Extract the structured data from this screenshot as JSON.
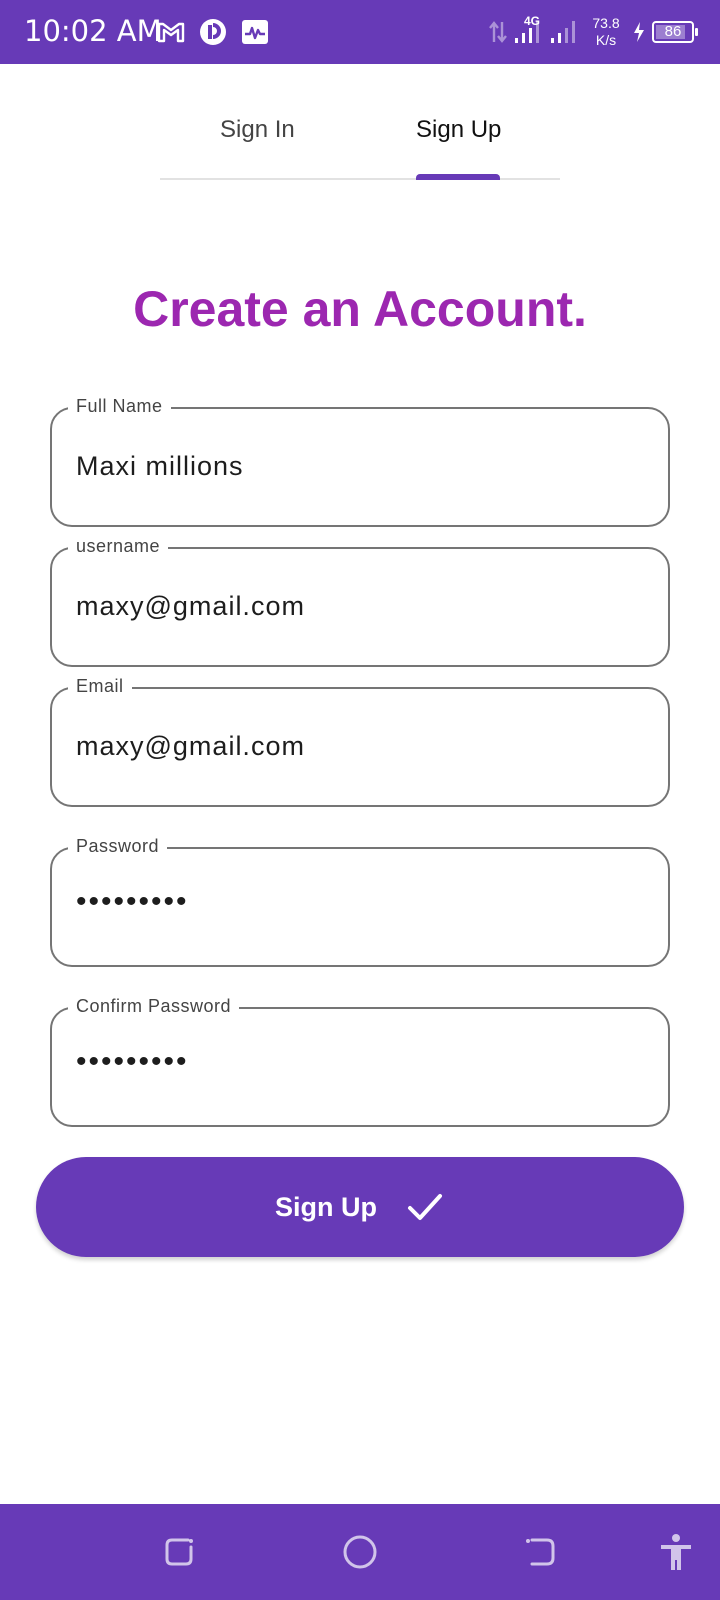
{
  "status_bar": {
    "time": "10:02 AM",
    "network_type": "4G",
    "net_speed_value": "73.8",
    "net_speed_unit": "K/s",
    "battery_level": "86",
    "battery_fraction": 0.86,
    "icons_left": [
      "gmail-icon",
      "app-r-icon",
      "activity-monitor-icon"
    ]
  },
  "tabs": {
    "sign_in": "Sign In",
    "sign_up": "Sign Up",
    "selected": "Sign Up"
  },
  "heading": "Create an Account.",
  "form": {
    "full_name": {
      "label": "Full Name",
      "value": "Maxi millions"
    },
    "username": {
      "label": "username",
      "value": "maxy@gmail.com"
    },
    "email": {
      "label": "Email",
      "value": "maxy@gmail.com"
    },
    "password": {
      "label": "Password",
      "value": "•••••••••"
    },
    "confirm_password": {
      "label": "Confirm Password",
      "value": "•••••••••"
    }
  },
  "submit_button": {
    "label": "Sign Up",
    "icon": "check-icon"
  },
  "nav_bar": {
    "icons": [
      "recents-icon",
      "home-icon",
      "back-icon",
      "accessibility-icon"
    ]
  },
  "colors": {
    "primary": "#673ab7",
    "heading": "#9c27b0",
    "field_border": "#757575"
  }
}
